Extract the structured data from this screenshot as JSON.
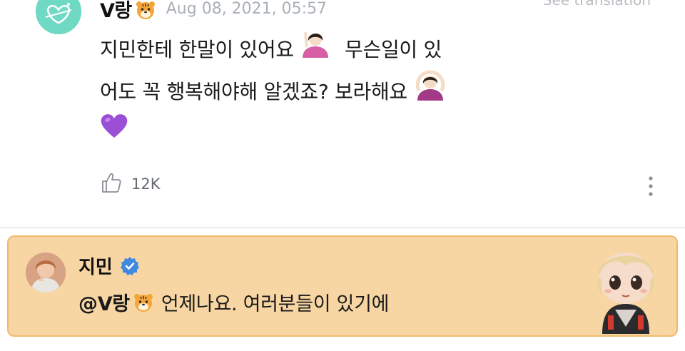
{
  "post": {
    "author": "V랑",
    "timestamp": "Aug 08, 2021, 05:57",
    "translate_link": "See translation",
    "text_line1": "지민한테 한말이 있어요",
    "text_line1b": "무슨일이 있",
    "text_line2": "어도 꼭 행복해야해 알겠죠? 보라해요",
    "likes": "12K"
  },
  "reply": {
    "author": "지민",
    "mention": "@V랑",
    "text": "언제나요. 여러분들이 있기에"
  },
  "icons": {
    "author_badge": "tiger-emoji",
    "emoji_1": "raising-hand-emoji",
    "emoji_2": "ok-gesture-emoji",
    "emoji_3": "purple-heart-emoji",
    "like": "thumbs-up-icon",
    "more": "vertical-dots-icon",
    "verified": "verified-badge-icon",
    "sticker": "chibi-character-sticker"
  },
  "colors": {
    "accent_reply_bg": "#f7d6a4",
    "accent_reply_border": "#f1b96a",
    "timestamp": "#aab0b8",
    "verified": "#3f8ae0",
    "heart": "#9b4fd6"
  }
}
